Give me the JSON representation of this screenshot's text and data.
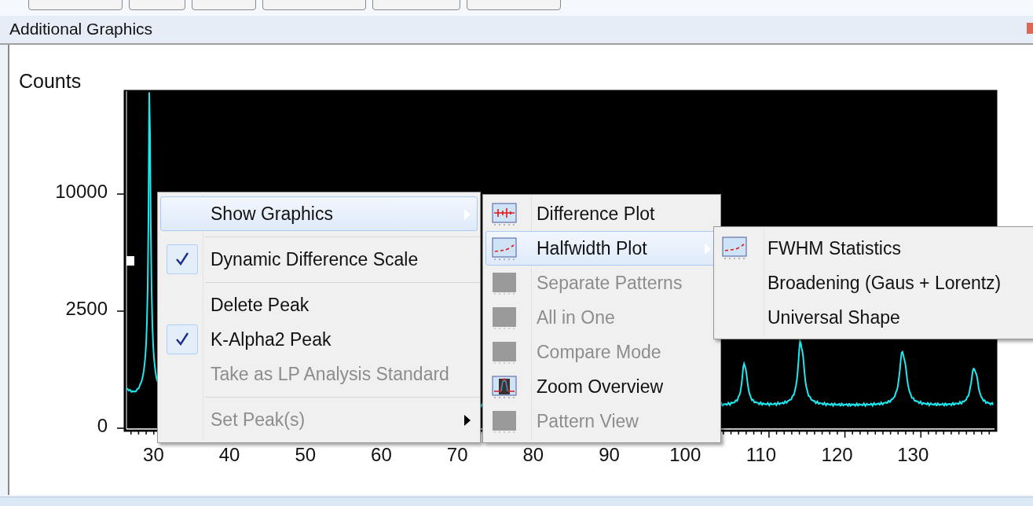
{
  "panel": {
    "title": "Additional Graphics"
  },
  "chart": {
    "ylabel": "Counts",
    "yticks": [
      "10000",
      "2500",
      "0"
    ],
    "xticks": [
      "30",
      "40",
      "50",
      "60",
      "70",
      "80",
      "90",
      "100",
      "110",
      "120",
      "130"
    ]
  },
  "context_menu": {
    "groups": [
      [
        {
          "label": "Show Graphics",
          "selected": true,
          "checked": false,
          "disabled": false,
          "submenu": true
        }
      ],
      [
        {
          "label": "Dynamic Difference Scale",
          "selected": false,
          "checked": true,
          "disabled": false,
          "submenu": false
        }
      ],
      [
        {
          "label": "Delete  Peak",
          "selected": false,
          "checked": false,
          "disabled": false,
          "submenu": false
        },
        {
          "label": "K-Alpha2 Peak",
          "selected": false,
          "checked": true,
          "disabled": false,
          "submenu": false
        },
        {
          "label": "Take as LP Analysis Standard",
          "selected": false,
          "checked": false,
          "disabled": true,
          "submenu": false
        }
      ],
      [
        {
          "label": "Set Peak(s)",
          "selected": false,
          "checked": false,
          "disabled": true,
          "submenu": true
        }
      ]
    ]
  },
  "graphics_submenu": {
    "items": [
      {
        "label": "Difference Plot",
        "kind": "difference",
        "selected": false,
        "disabled": false,
        "submenu": false
      },
      {
        "label": "Halfwidth Plot",
        "kind": "halfwidth",
        "selected": true,
        "disabled": false,
        "submenu": true
      },
      {
        "label": "Separate Patterns",
        "kind": "blank",
        "selected": false,
        "disabled": true,
        "submenu": false
      },
      {
        "label": "All in One",
        "kind": "blank",
        "selected": false,
        "disabled": true,
        "submenu": false
      },
      {
        "label": "Compare Mode",
        "kind": "blank",
        "selected": false,
        "disabled": true,
        "submenu": false
      },
      {
        "label": "Zoom Overview",
        "kind": "zoom",
        "selected": false,
        "disabled": false,
        "submenu": false
      },
      {
        "label": "Pattern View",
        "kind": "blank",
        "selected": false,
        "disabled": true,
        "submenu": false
      }
    ]
  },
  "halfwidth_submenu": {
    "items": [
      {
        "label": "FWHM Statistics",
        "kind": "halfwidth"
      },
      {
        "label": "Broadening (Gaus + Lorentz)",
        "kind": "plain"
      },
      {
        "label": "Universal Shape",
        "kind": "plain"
      }
    ]
  }
}
